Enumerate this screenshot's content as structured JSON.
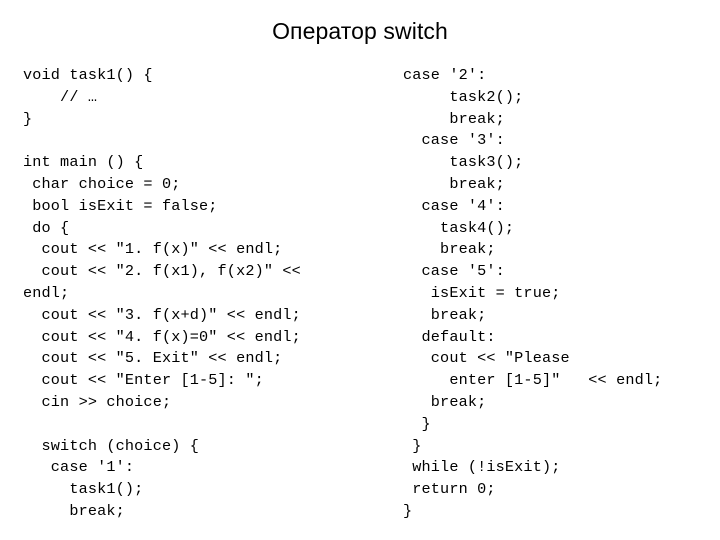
{
  "slide": {
    "title": "Оператор switch",
    "background_color": "#ffffff",
    "text_color": "#000000"
  },
  "code": {
    "language": "cpp",
    "left_column": [
      "void task1() {",
      "    // …",
      "}",
      "",
      "int main () {",
      " char choice = 0;",
      " bool isExit = false;",
      " do {",
      "  cout << \"1. f(x)\" << endl;",
      "  cout << \"2. f(x1), f(x2)\" <<",
      "endl;",
      "  cout << \"3. f(x+d)\" << endl;",
      "  cout << \"4. f(x)=0\" << endl;",
      "  cout << \"5. Exit\" << endl;",
      "  cout << \"Enter [1-5]: \";",
      "  cin >> choice;",
      "",
      "  switch (choice) {",
      "   case '1':",
      "     task1();",
      "     break;"
    ],
    "right_column": [
      "case '2':",
      "     task2();",
      "     break;",
      "  case '3':",
      "     task3();",
      "     break;",
      "  case '4':",
      "    task4();",
      "    break;",
      "  case '5':",
      "   isExit = true;",
      "   break;",
      "  default:",
      "   cout << \"Please",
      "     enter [1-5]\"   << endl;",
      "   break;",
      "  }",
      " }",
      " while (!isExit);",
      " return 0;",
      "}"
    ]
  }
}
